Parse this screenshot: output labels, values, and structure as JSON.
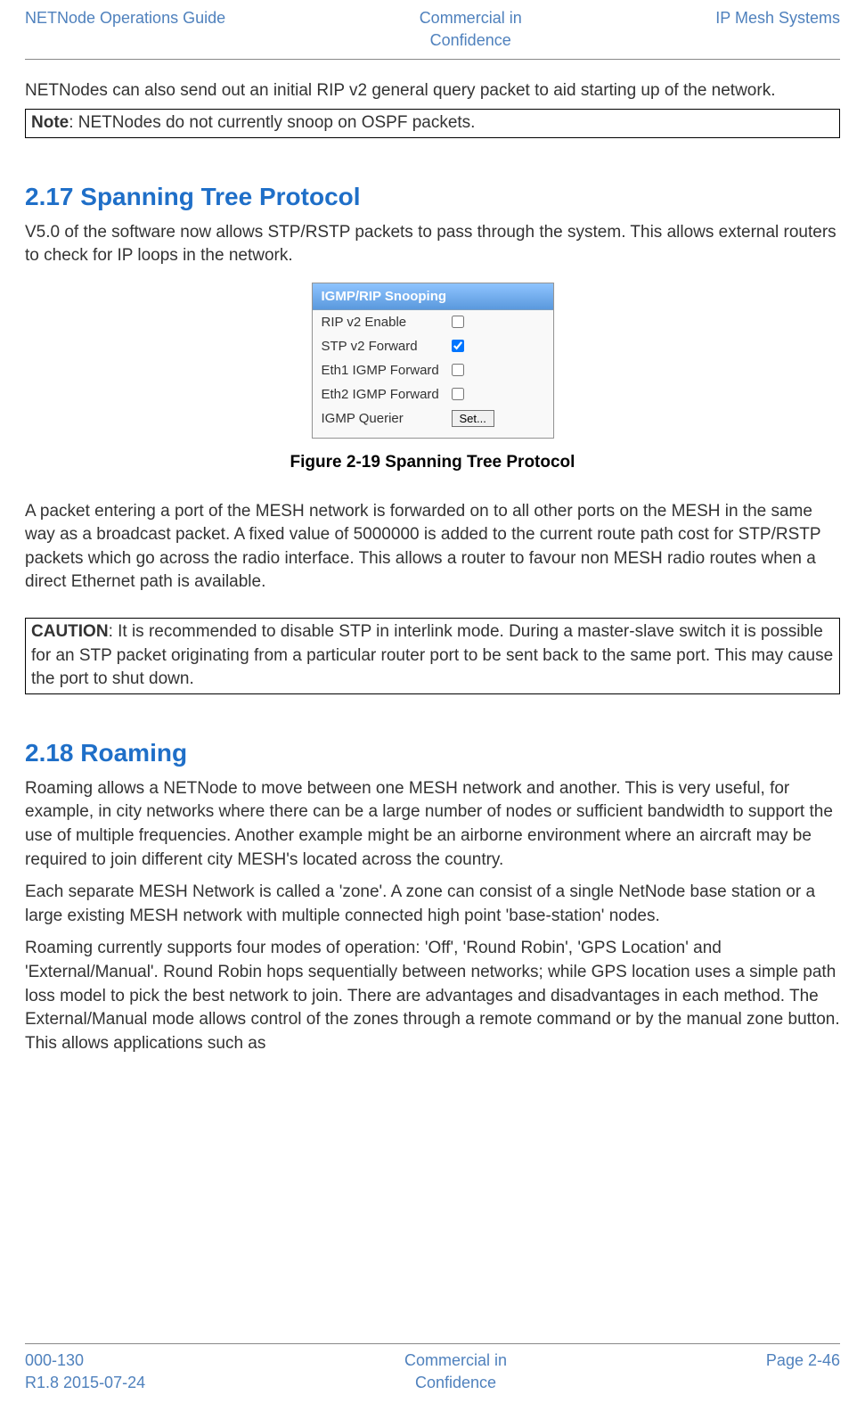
{
  "header": {
    "left": "NETNode Operations Guide",
    "center_line1": "Commercial in",
    "center_line2": "Confidence",
    "right": "IP Mesh Systems"
  },
  "intro_para": "NETNodes can also send out an initial RIP v2 general query packet to aid starting up of the network.",
  "note": {
    "label": "Note",
    "text": ": NETNodes do not currently snoop on OSPF packets."
  },
  "section_217": {
    "heading": "2.17 Spanning Tree Protocol",
    "para1": "V5.0 of the software now allows STP/RSTP packets to pass through the system. This allows external routers to check for IP loops in the network.",
    "panel": {
      "title": "IGMP/RIP Snooping",
      "row1_label": "RIP v2 Enable",
      "row2_label": "STP v2 Forward",
      "row3_label": "Eth1 IGMP Forward",
      "row4_label": "Eth2 IGMP Forward",
      "row5_label": "IGMP Querier",
      "button_label": "Set..."
    },
    "figure_caption": "Figure 2-19 Spanning Tree Protocol",
    "para2": "A packet entering a port of the MESH network is forwarded on to all other ports on the MESH in the same way as a broadcast packet. A fixed value of 5000000 is added to the current route path cost for STP/RSTP packets which go across the radio interface. This allows a router to favour non MESH radio routes when a direct Ethernet path is available."
  },
  "caution": {
    "label": "CAUTION",
    "text": ": It is recommended to disable STP in interlink mode. During a master-slave switch it is possible for an STP packet originating from a particular router port to be sent back to the same port. This may cause the port to shut down."
  },
  "section_218": {
    "heading": "2.18 Roaming",
    "para1": "Roaming allows a NETNode to move between one MESH network and another. This is very useful, for example, in city networks where there can be a large number of nodes or sufficient bandwidth to support the use of multiple frequencies. Another example might be an airborne environment where an aircraft may be required to join different city MESH's located across the country.",
    "para2": "Each separate MESH Network is called a 'zone'. A zone can consist of a single NetNode base station or a large existing MESH network with multiple connected high point 'base-station' nodes.",
    "para3": "Roaming currently supports four modes of operation: 'Off', 'Round Robin', 'GPS Location' and 'External/Manual'. Round Robin hops sequentially between networks; while GPS location uses a simple path loss model to pick the best network to join. There are advantages and disadvantages in each method. The External/Manual mode allows control of the zones through a remote command or by the manual zone button. This allows applications such as"
  },
  "footer": {
    "left_line1": "000-130",
    "left_line2": "R1.8 2015-07-24",
    "center_line1": "Commercial in",
    "center_line2": "Confidence",
    "right": "Page 2-46"
  }
}
